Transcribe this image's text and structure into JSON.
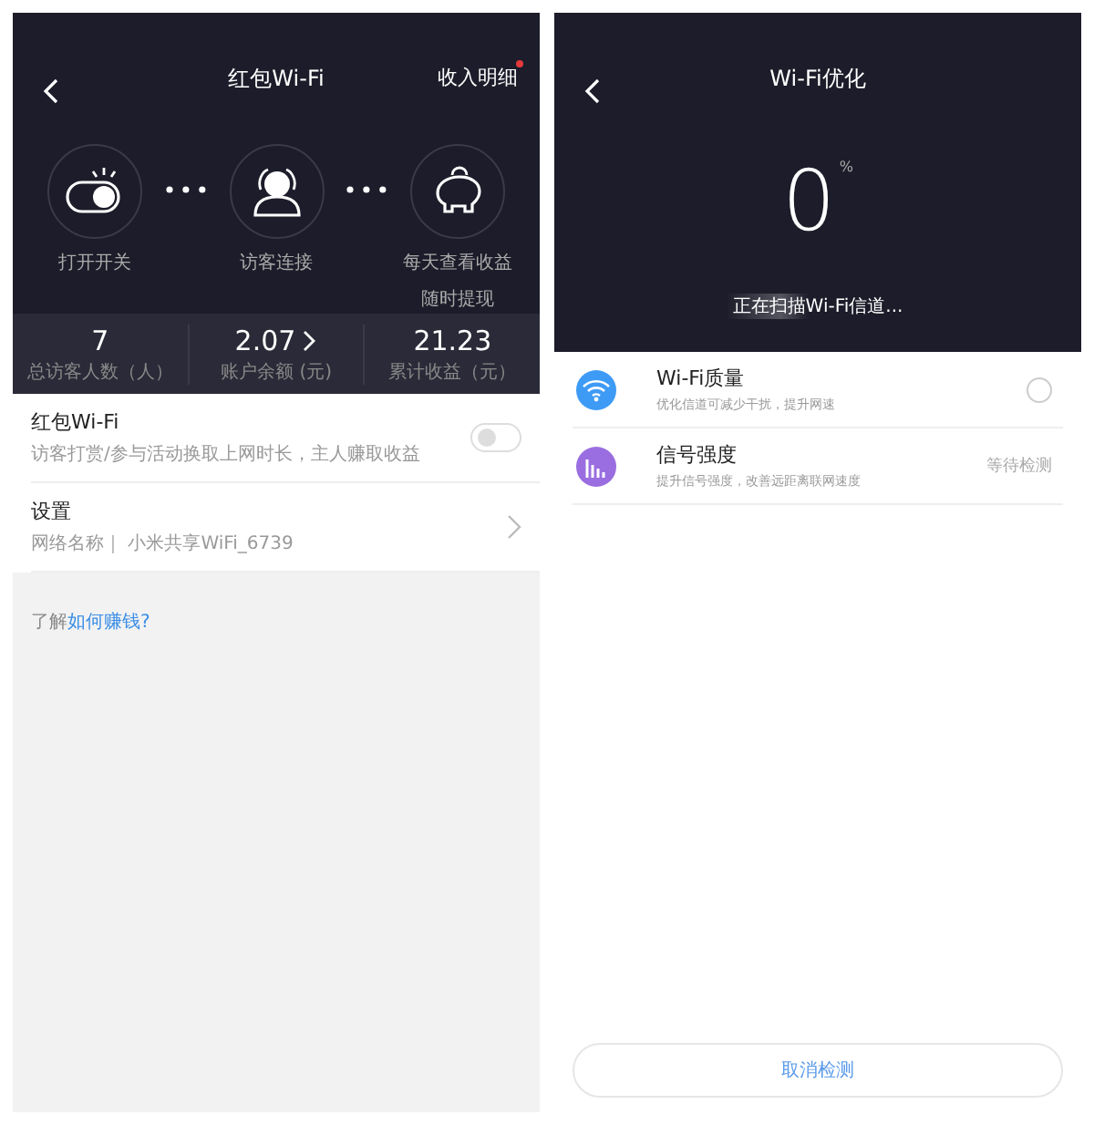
{
  "left": {
    "title": "红包Wi-Fi",
    "action": "收入明细",
    "action_badge": true,
    "steps": [
      {
        "kind": "switch",
        "label": "打开开关"
      },
      {
        "kind": "visitor",
        "label": "访客连接"
      },
      {
        "kind": "piggy",
        "label": "每天查看收益",
        "label_2": "随时提现"
      }
    ],
    "stats": [
      {
        "value": "7",
        "label": "总访客人数（人）",
        "link": false
      },
      {
        "value": "2.07",
        "label": "账户余额 (元)",
        "link": true
      },
      {
        "value": "21.23",
        "label": "累计收益（元）",
        "link": false
      }
    ],
    "toggle_row": {
      "title": "红包Wi-Fi",
      "subtitle": "访客打赏/参与活动换取上网时长，主人赚取收益",
      "on": false
    },
    "settings_row": {
      "title": "设置",
      "label": "网络名称｜",
      "value": "小米共享WiFi_6739"
    },
    "help": {
      "text": "了解",
      "link": "如何赚钱?"
    }
  },
  "right": {
    "title": "Wi-Fi优化",
    "percent": "0",
    "unit": "%",
    "scan_text": "正在扫描Wi-Fi信道...",
    "checks": [
      {
        "kind": "wifi",
        "color": "#3e9bf5",
        "title": "Wi-Fi质量",
        "subtitle": "优化信道可减少干扰，提升网速",
        "checked": false
      },
      {
        "kind": "signal",
        "color": "#9a6ee0",
        "title": "信号强度",
        "subtitle": "提升信号强度，改善远距离联网速度",
        "status": "等待检测"
      }
    ],
    "cancel": "取消检测"
  }
}
